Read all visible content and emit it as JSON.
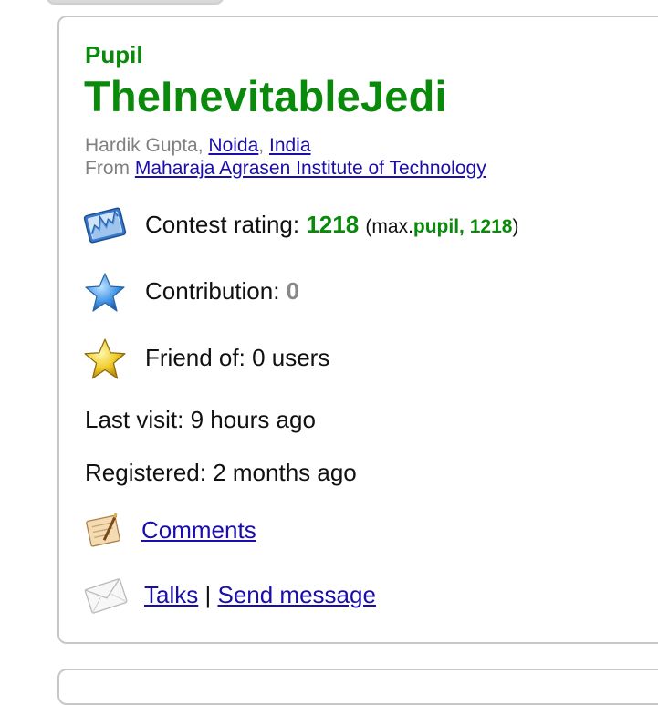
{
  "profile": {
    "rank": "Pupil",
    "handle": "TheInevitableJedi",
    "name": "Hardik Gupta",
    "name_sep": ",",
    "city": "Noida",
    "city_sep": ",",
    "country": "India",
    "from_label": "From",
    "organization": "Maharaja Agrasen Institute of Technology"
  },
  "stats": {
    "rating_label": "Contest rating:",
    "rating_value": "1218",
    "max_open": "(max.",
    "max_rank": "pupil, 1218",
    "max_close": ")",
    "contribution_label": "Contribution:",
    "contribution_value": "0",
    "friend_label": "Friend of:",
    "friend_value": "0 users",
    "last_visit_label": "Last visit:",
    "last_visit_value": "9 hours ago",
    "registered_label": "Registered:",
    "registered_value": "2 months ago"
  },
  "links": {
    "comments": "Comments",
    "talks": "Talks",
    "separator": "|",
    "send_message": "Send message"
  },
  "colors": {
    "rank_green": "#0a8a0a",
    "link_blue": "#1a0dab",
    "muted_gray": "#808080"
  },
  "icons": [
    "rating-chart-icon",
    "blue-star-icon",
    "gold-star-icon",
    "notepad-icon",
    "envelope-icon"
  ]
}
